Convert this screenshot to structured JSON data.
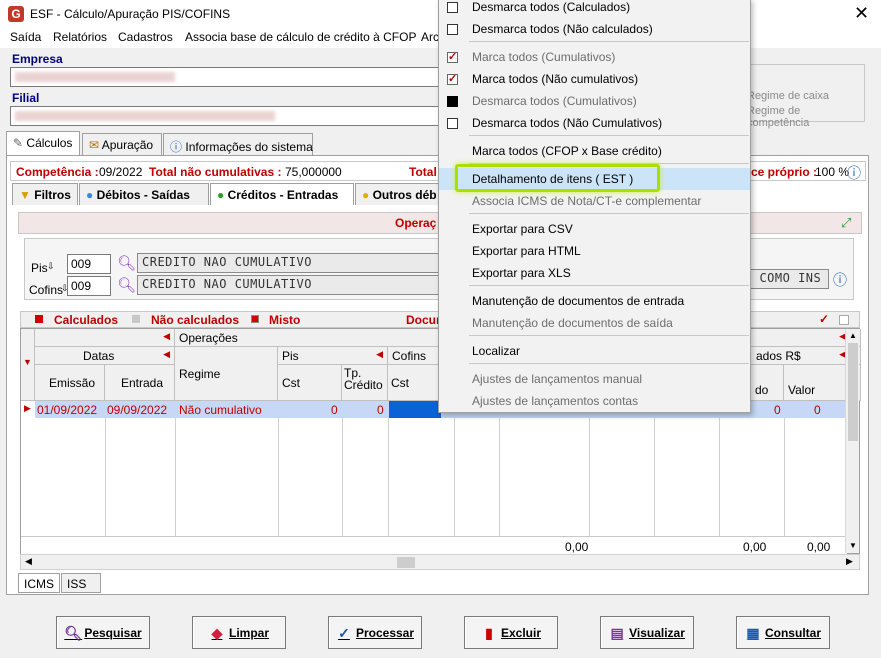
{
  "window": {
    "title": "ESF - Cálculo/Apuração PIS/COFINS",
    "logo": "G",
    "close": "✕"
  },
  "menubar": [
    "Saída",
    "Relatórios",
    "Cadastros",
    "Associa base de cálculo de crédito à CFOP",
    "Arc"
  ],
  "empresa": {
    "label": "Empresa",
    "value_blurred": ""
  },
  "filial": {
    "label": "Filial",
    "value_blurred": ""
  },
  "regime_box": {
    "line1": "Regime de caixa",
    "line2": "Regime de competência"
  },
  "tabs": [
    "Cálculos",
    "Apuração",
    "Informações do sistema"
  ],
  "infobar": {
    "competencia_label": "Competência :",
    "competencia_value": "09/2022",
    "total_label": "Total não cumulativas :",
    "total_value": "75,000000",
    "total2_label": "Total",
    "right_label": "ce próprio :",
    "right_value": "100 %"
  },
  "subtabs": [
    "Filtros",
    "Débitos - Saídas",
    "Créditos - Entradas",
    "Outros déb"
  ],
  "section_title": "Operaç",
  "pis": {
    "label": "Pis",
    "code": "009",
    "desc": "CREDITO NAO CUMULATIVO"
  },
  "cofins": {
    "label": "Cofins",
    "code": "009",
    "desc": "CREDITO NAO CUMULATIVO"
  },
  "side_text": "S COMO INS",
  "legend": {
    "calculados": "Calculados",
    "nao_calculados": "Não calculados",
    "misto": "Misto",
    "docu": "Docum"
  },
  "grid": {
    "headers": {
      "operacoes": "Operações",
      "datas": "Datas",
      "emissao": "Emissão",
      "entrada": "Entrada",
      "regime": "Regime",
      "pis": "Pis",
      "cst": "Cst",
      "tp_credito": "Tp. Crédito",
      "cofins": "Cofins",
      "cofins_cst": "Cst",
      "ados": "ados R$",
      "do": "do",
      "valor": "Valor"
    },
    "row": {
      "emissao": "01/09/2022",
      "entrada": "09/09/2022",
      "regime": "Não cumulativo",
      "cst": "0",
      "tp": "0",
      "c1": "0",
      "c2": "0"
    },
    "totals": {
      "t1": "0,00",
      "t2": "0,00",
      "t3": "0,00"
    }
  },
  "bottom_tabs": [
    "ICMS",
    "ISS"
  ],
  "buttons": [
    {
      "label": "Pesquisar",
      "icon": "search-icon"
    },
    {
      "label": "Limpar",
      "icon": "eraser-icon"
    },
    {
      "label": "Processar",
      "icon": "check-icon"
    },
    {
      "label": "Excluir",
      "icon": "trash-icon"
    },
    {
      "label": "Visualizar",
      "icon": "printer-icon"
    },
    {
      "label": "Consultar",
      "icon": "table-icon"
    }
  ],
  "context_menu": {
    "items": [
      {
        "label": "Desmarca todos (Calculados)",
        "check": "empty",
        "disabled": false
      },
      {
        "label": "Desmarca todos (Não calculados)",
        "check": "empty",
        "disabled": false
      },
      {
        "label": "Marca todos (Cumulativos)",
        "check": "red",
        "disabled": true
      },
      {
        "label": "Marca todos (Não cumulativos)",
        "check": "red",
        "disabled": false
      },
      {
        "label": "Desmarca todos (Cumulativos)",
        "check": "black",
        "disabled": true
      },
      {
        "label": "Desmarca todos (Não Cumulativos)",
        "check": "empty",
        "disabled": false
      },
      {
        "label": "Marca todos (CFOP x Base crédito)",
        "check": "none",
        "disabled": false
      },
      {
        "label": "Detalhamento de itens ( EST )",
        "check": "none",
        "disabled": false
      },
      {
        "label": "Associa ICMS de Nota/CT-e complementar",
        "check": "none",
        "disabled": true
      },
      {
        "label": "Exportar para CSV",
        "check": "none",
        "disabled": false
      },
      {
        "label": "Exportar para HTML",
        "check": "none",
        "disabled": false
      },
      {
        "label": "Exportar para XLS",
        "check": "none",
        "disabled": false
      },
      {
        "label": "Manutenção de documentos de entrada",
        "check": "none",
        "disabled": false
      },
      {
        "label": "Manutenção de documentos de saída",
        "check": "none",
        "disabled": true
      },
      {
        "label": "Localizar",
        "check": "none",
        "disabled": false
      },
      {
        "label": "Ajustes de lançamentos manual",
        "check": "none",
        "disabled": true
      },
      {
        "label": "Ajustes de lançamentos contas",
        "check": "none",
        "disabled": true
      }
    ]
  }
}
